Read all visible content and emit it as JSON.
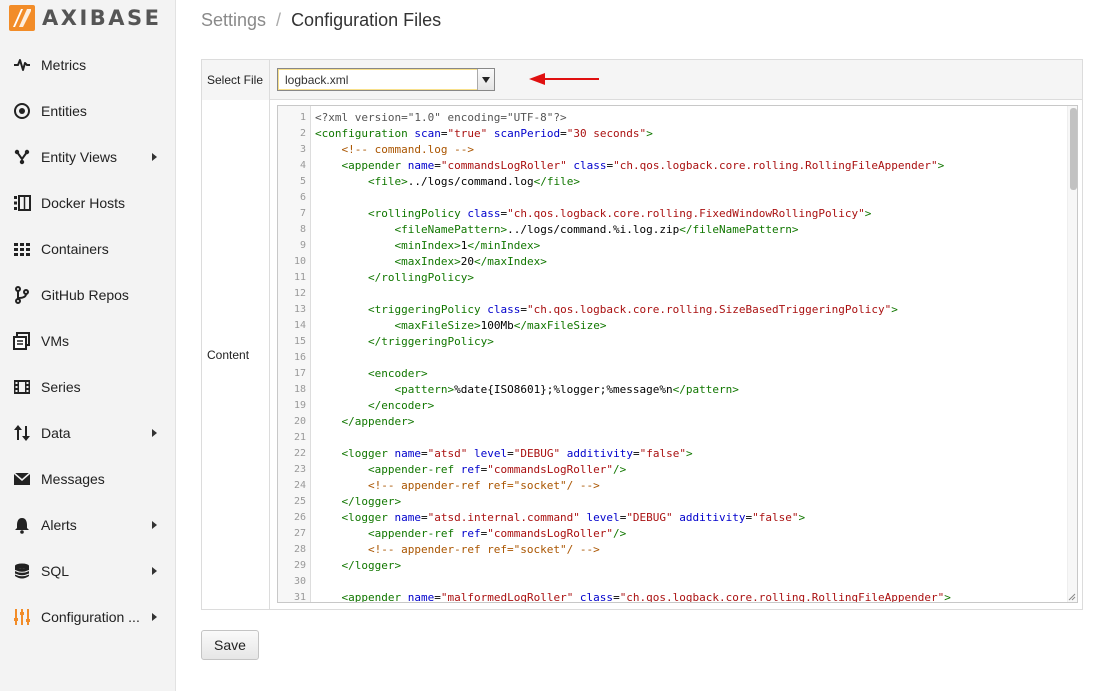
{
  "brand": {
    "name": "AXIBASE",
    "mark_color": "#f28c28"
  },
  "sidebar": {
    "items": [
      {
        "label": "Metrics",
        "icon": "pulse-icon",
        "submenu": false
      },
      {
        "label": "Entities",
        "icon": "target-icon",
        "submenu": false
      },
      {
        "label": "Entity Views",
        "icon": "branch-icon",
        "submenu": true
      },
      {
        "label": "Docker Hosts",
        "icon": "docker-host-icon",
        "submenu": false
      },
      {
        "label": "Containers",
        "icon": "containers-icon",
        "submenu": false
      },
      {
        "label": "GitHub Repos",
        "icon": "git-fork-icon",
        "submenu": false
      },
      {
        "label": "VMs",
        "icon": "vm-icon",
        "submenu": false
      },
      {
        "label": "Series",
        "icon": "film-icon",
        "submenu": false
      },
      {
        "label": "Data",
        "icon": "up-down-arrows-icon",
        "submenu": true
      },
      {
        "label": "Messages",
        "icon": "envelope-icon",
        "submenu": false
      },
      {
        "label": "Alerts",
        "icon": "bell-icon",
        "submenu": true
      },
      {
        "label": "SQL",
        "icon": "database-icon",
        "submenu": true
      },
      {
        "label": "Configuration ...",
        "icon": "sliders-icon",
        "submenu": true,
        "accent": "#f28c28"
      }
    ]
  },
  "breadcrumb": {
    "parent": "Settings",
    "separator": "/",
    "current": "Configuration Files"
  },
  "form": {
    "select_file_label": "Select File",
    "selected_file": "logback.xml",
    "content_label": "Content",
    "save_label": "Save"
  },
  "annotation": {
    "arrow_color": "#e01010"
  },
  "editor": {
    "lines": [
      "<?xml version=\"1.0\" encoding=\"UTF-8\"?>",
      "<configuration scan=\"true\" scanPeriod=\"30 seconds\">",
      "    <!-- command.log -->",
      "    <appender name=\"commandsLogRoller\" class=\"ch.qos.logback.core.rolling.RollingFileAppender\">",
      "        <file>../logs/command.log</file>",
      "",
      "        <rollingPolicy class=\"ch.qos.logback.core.rolling.FixedWindowRollingPolicy\">",
      "            <fileNamePattern>../logs/command.%i.log.zip</fileNamePattern>",
      "            <minIndex>1</minIndex>",
      "            <maxIndex>20</maxIndex>",
      "        </rollingPolicy>",
      "",
      "        <triggeringPolicy class=\"ch.qos.logback.core.rolling.SizeBasedTriggeringPolicy\">",
      "            <maxFileSize>100Mb</maxFileSize>",
      "        </triggeringPolicy>",
      "",
      "        <encoder>",
      "            <pattern>%date{ISO8601};%logger;%message%n</pattern>",
      "        </encoder>",
      "    </appender>",
      "",
      "    <logger name=\"atsd\" level=\"DEBUG\" additivity=\"false\">",
      "        <appender-ref ref=\"commandsLogRoller\"/>",
      "        <!-- appender-ref ref=\"socket\"/ -->",
      "    </logger>",
      "    <logger name=\"atsd.internal.command\" level=\"DEBUG\" additivity=\"false\">",
      "        <appender-ref ref=\"commandsLogRoller\"/>",
      "        <!-- appender-ref ref=\"socket\"/ -->",
      "    </logger>",
      "",
      "    <appender name=\"malformedLogRoller\" class=\"ch.qos.logback.core.rolling.RollingFileAppender\">"
    ]
  }
}
